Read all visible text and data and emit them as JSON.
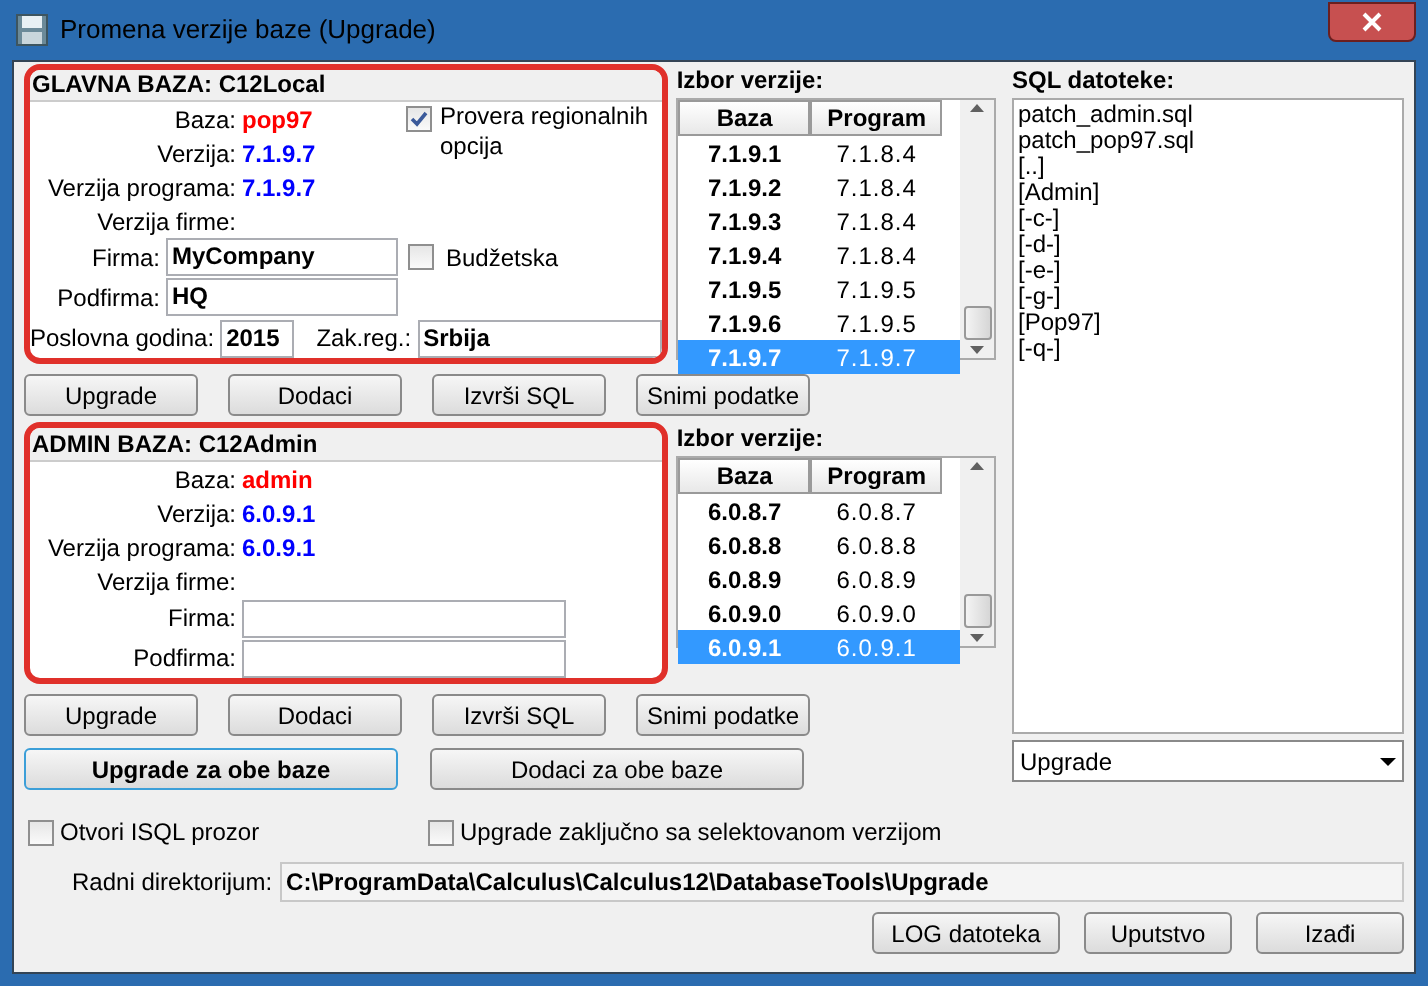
{
  "window": {
    "title": "Promena verzije baze (Upgrade)"
  },
  "main_db": {
    "heading": "GLAVNA BAZA: C12Local",
    "info": [
      {
        "label": "Baza:",
        "value": "pop97",
        "kind": "name"
      },
      {
        "label": "Verzija:",
        "value": "7.1.9.7",
        "kind": "version"
      },
      {
        "label": "Verzija programa:",
        "value": "7.1.9.7",
        "kind": "version"
      },
      {
        "label": "Verzija firme:",
        "kind": "empty"
      }
    ],
    "regional_check": {
      "label": "Provera regionalnih opcija",
      "checked": true
    },
    "firma": {
      "label": "Firma:",
      "value": "MyCompany"
    },
    "budget_check": {
      "label": "Budžetska",
      "checked": false
    },
    "podfirma": {
      "label": "Podfirma:",
      "value": "HQ"
    },
    "year": {
      "label": "Poslovna godina:",
      "value": "2015"
    },
    "region": {
      "label": "Zak.reg.:",
      "value": "Srbija"
    }
  },
  "main_versions": {
    "heading": "Izbor verzije:",
    "columns": [
      "Baza",
      "Program"
    ],
    "rows": [
      {
        "baza": "7.1.9.1",
        "program": "7.1.8.4",
        "selected": false
      },
      {
        "baza": "7.1.9.2",
        "program": "7.1.8.4",
        "selected": false
      },
      {
        "baza": "7.1.9.3",
        "program": "7.1.8.4",
        "selected": false
      },
      {
        "baza": "7.1.9.4",
        "program": "7.1.8.4",
        "selected": false
      },
      {
        "baza": "7.1.9.5",
        "program": "7.1.9.5",
        "selected": false
      },
      {
        "baza": "7.1.9.6",
        "program": "7.1.9.5",
        "selected": false
      },
      {
        "baza": "7.1.9.7",
        "program": "7.1.9.7",
        "selected": true
      }
    ]
  },
  "main_buttons": [
    "Upgrade",
    "Dodaci",
    "Izvrši SQL",
    "Snimi podatke"
  ],
  "admin_db": {
    "heading": "ADMIN BAZA: C12Admin",
    "info": [
      {
        "label": "Baza:",
        "value": "admin",
        "kind": "name"
      },
      {
        "label": "Verzija:",
        "value": "6.0.9.1",
        "kind": "version"
      },
      {
        "label": "Verzija programa:",
        "value": "6.0.9.1",
        "kind": "version"
      },
      {
        "label": "Verzija firme:",
        "kind": "empty"
      }
    ],
    "firma": {
      "label": "Firma:"
    },
    "podfirma": {
      "label": "Podfirma:"
    }
  },
  "admin_versions": {
    "heading": "Izbor verzije:",
    "columns": [
      "Baza",
      "Program"
    ],
    "rows": [
      {
        "baza": "6.0.8.7",
        "program": "6.0.8.7",
        "selected": false
      },
      {
        "baza": "6.0.8.8",
        "program": "6.0.8.8",
        "selected": false
      },
      {
        "baza": "6.0.8.9",
        "program": "6.0.8.9",
        "selected": false
      },
      {
        "baza": "6.0.9.0",
        "program": "6.0.9.0",
        "selected": false
      },
      {
        "baza": "6.0.9.1",
        "program": "6.0.9.1",
        "selected": true
      }
    ]
  },
  "admin_buttons": [
    "Upgrade",
    "Dodaci",
    "Izvrši SQL",
    "Snimi podatke"
  ],
  "both_buttons": [
    {
      "label": "Upgrade za obe baze",
      "focused": true
    },
    {
      "label": "Dodaci za obe baze",
      "focused": false
    }
  ],
  "sql_files": {
    "heading": "SQL datoteke:",
    "items": [
      "patch_admin.sql",
      "patch_pop97.sql",
      "[..]",
      "[Admin]",
      "[-c-]",
      "[-d-]",
      "[-e-]",
      "[-g-]",
      "[Pop97]",
      "[-q-]"
    ]
  },
  "mode_select": {
    "value": "Upgrade"
  },
  "isql_check": {
    "label": "Otvori ISQL prozor",
    "checked": false
  },
  "final_check": {
    "label": "Upgrade zaključno sa selektovanom verzijom",
    "checked": false
  },
  "work_dir": {
    "label": "Radni direktorijum:",
    "value": "C:\\ProgramData\\Calculus\\Calculus12\\DatabaseTools\\Upgrade"
  },
  "footer_buttons": [
    "LOG datoteka",
    "Uputstvo",
    "Izađi"
  ]
}
